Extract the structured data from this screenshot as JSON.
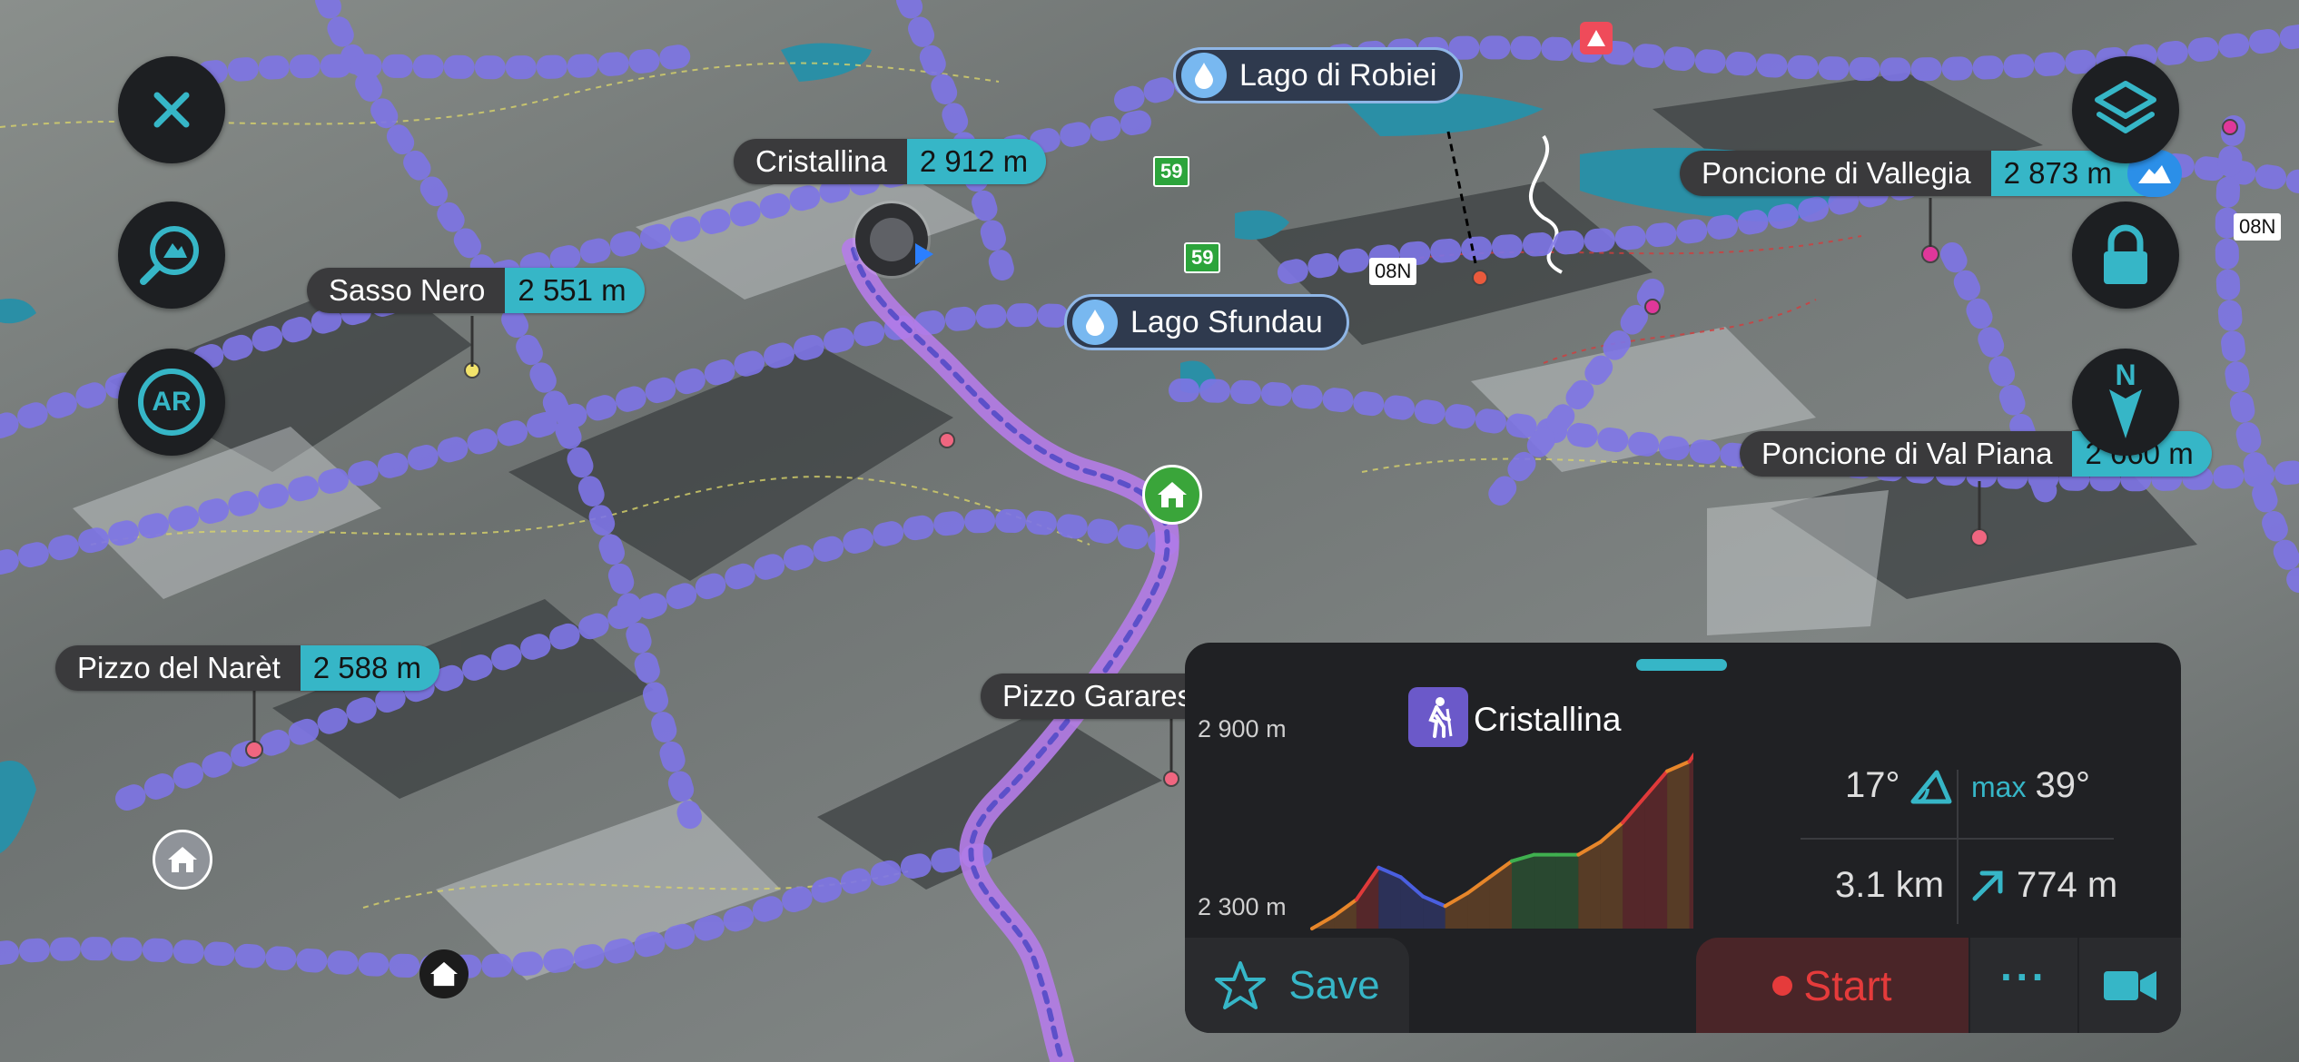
{
  "controls": {
    "close_icon": "close-icon",
    "peak_finder_icon": "peak-finder-icon",
    "ar_label": "AR",
    "layers_icon": "layers-icon",
    "lock_icon": "lock-icon",
    "compass_label": "N"
  },
  "peaks": [
    {
      "name": "Cristallina",
      "elevation": "2 912 m"
    },
    {
      "name": "Sasso Nero",
      "elevation": "2 551 m"
    },
    {
      "name": "Pizzo del Narèt",
      "elevation": "2 588 m"
    },
    {
      "name": "Poncione di Vallegia",
      "elevation": "2 873 m"
    },
    {
      "name": "Poncione di Val Piana",
      "elevation": "2 660 m"
    },
    {
      "name": "Pizzo Garares",
      "elevation": ""
    }
  ],
  "lakes": [
    {
      "name": "Lago di Robiei"
    },
    {
      "name": "Lago Sfundau"
    }
  ],
  "badges": {
    "route_59_a": "59",
    "route_59_b": "59",
    "road_08n_a": "08N",
    "road_08n_b": "08N"
  },
  "panel": {
    "destination": "Cristallina",
    "y_axis_top": "2 900 m",
    "y_axis_bottom": "2 300 m",
    "slope_avg": "17°",
    "slope_max_label": "max",
    "slope_max": "39°",
    "distance": "3.1 km",
    "ascent": "774 m",
    "save_label": "Save",
    "start_label": "Start",
    "more_label": "···"
  },
  "chart_data": {
    "type": "area",
    "title": "",
    "xlabel": "",
    "ylabel": "",
    "y_tick_labels": [
      "2 900 m",
      "2 300 m"
    ],
    "ylim": [
      2300,
      2900
    ],
    "x": [
      0,
      1,
      2,
      3,
      4,
      5,
      6,
      7,
      8,
      9,
      10,
      11,
      12,
      13,
      14,
      15,
      16,
      17,
      18,
      19,
      20
    ],
    "values": [
      2290,
      2330,
      2380,
      2480,
      2450,
      2390,
      2360,
      2400,
      2450,
      2500,
      2520,
      2520,
      2520,
      2560,
      2620,
      2700,
      2780,
      2810,
      2912,
      2912,
      2912
    ],
    "colors": {
      "steep": "#e03a3a",
      "medium": "#e7862a",
      "flat": "#3fb04f",
      "descent": "#4a5fe0"
    }
  },
  "colors": {
    "accent": "#36b6c7",
    "start_red": "#e53b3b",
    "trail_purple": "#6d5de0",
    "route_purple": "#b57ce8",
    "panel_bg": "#202124"
  }
}
